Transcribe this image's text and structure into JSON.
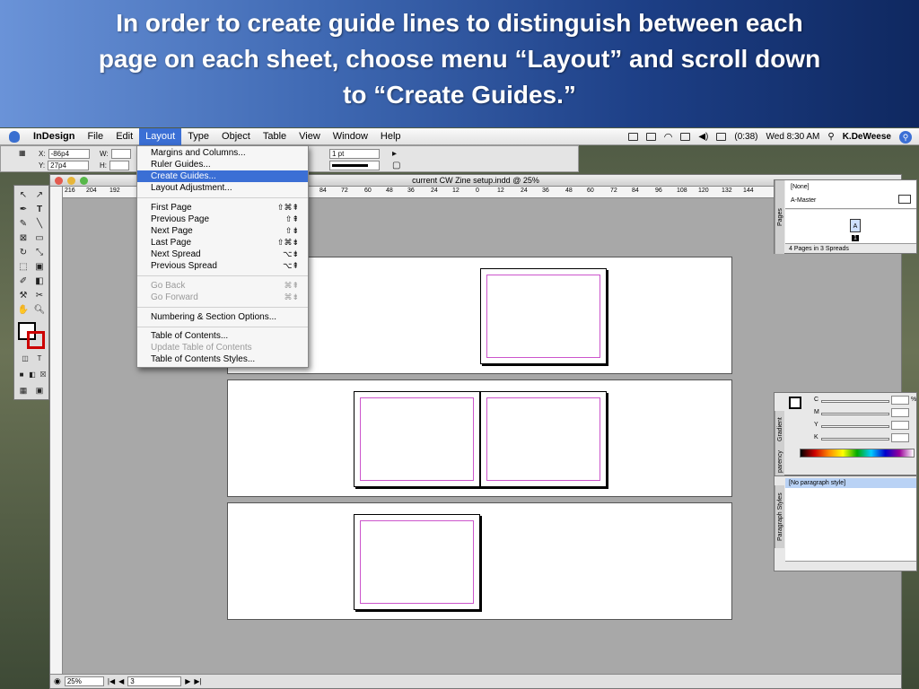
{
  "slide": {
    "caption_lines": [
      "In order to create guide lines to distinguish between each",
      "page on each sheet, choose menu “Layout” and scroll down",
      "to “Create Guides.”"
    ]
  },
  "menubar": {
    "app": "InDesign",
    "items": [
      "File",
      "Edit",
      "Layout",
      "Type",
      "Object",
      "Table",
      "View",
      "Window",
      "Help"
    ],
    "active": "Layout",
    "battery": "(0:38)",
    "clock": "Wed 8:30 AM",
    "user": "K.DeWeese"
  },
  "control": {
    "x_label": "X:",
    "x_value": "-86p4",
    "y_label": "Y:",
    "y_value": "27p4",
    "w_label": "W:",
    "h_label": "H:",
    "stroke_weight": "1 pt"
  },
  "document": {
    "title": "current CW Zine setup.indd @ 25%",
    "ruler_ticks": [
      "216",
      "204",
      "192",
      "84",
      "72",
      "60",
      "48",
      "36",
      "24",
      "12",
      "0",
      "12",
      "24",
      "36",
      "48",
      "60",
      "72",
      "84",
      "96",
      "108",
      "120",
      "132",
      "144"
    ],
    "zoom": "25%",
    "page_field": "3"
  },
  "layout_menu": {
    "items": [
      {
        "label": "Margins and Columns...",
        "shortcut": "",
        "state": "normal"
      },
      {
        "label": "Ruler Guides...",
        "shortcut": "",
        "state": "normal"
      },
      {
        "label": "Create Guides...",
        "shortcut": "",
        "state": "highlighted"
      },
      {
        "label": "Layout Adjustment...",
        "shortcut": "",
        "state": "normal"
      },
      {
        "label": "First Page",
        "shortcut": "⇧⌘⇞",
        "state": "normal"
      },
      {
        "label": "Previous Page",
        "shortcut": "⇧⇞",
        "state": "normal"
      },
      {
        "label": "Next Page",
        "shortcut": "⇧⇟",
        "state": "normal"
      },
      {
        "label": "Last Page",
        "shortcut": "⇧⌘⇟",
        "state": "normal"
      },
      {
        "label": "Next Spread",
        "shortcut": "⌥⇟",
        "state": "normal"
      },
      {
        "label": "Previous Spread",
        "shortcut": "⌥⇞",
        "state": "normal"
      },
      {
        "label": "Go Back",
        "shortcut": "⌘⇞",
        "state": "disabled"
      },
      {
        "label": "Go Forward",
        "shortcut": "⌘⇟",
        "state": "disabled"
      },
      {
        "label": "Numbering & Section Options...",
        "shortcut": "",
        "state": "normal"
      },
      {
        "label": "Table of Contents...",
        "shortcut": "",
        "state": "normal"
      },
      {
        "label": "Update Table of Contents",
        "shortcut": "",
        "state": "disabled"
      },
      {
        "label": "Table of Contents Styles...",
        "shortcut": "",
        "state": "normal"
      }
    ]
  },
  "pages_panel": {
    "tab": "Pages",
    "none_label": "[None]",
    "master_label": "A-Master",
    "page_letter": "A",
    "page_number": "1",
    "footer": "4 Pages in 3 Spreads"
  },
  "color_panel": {
    "tabs": [
      "Gradient",
      "parency"
    ],
    "channels": [
      "C",
      "M",
      "Y",
      "K"
    ],
    "unit": "%"
  },
  "paragraph_panel": {
    "tab": "Paragraph Styles",
    "style": "[No paragraph style]"
  },
  "colors": {
    "accent": "#3b6fd5",
    "margin_guide": "#cc55cc"
  }
}
